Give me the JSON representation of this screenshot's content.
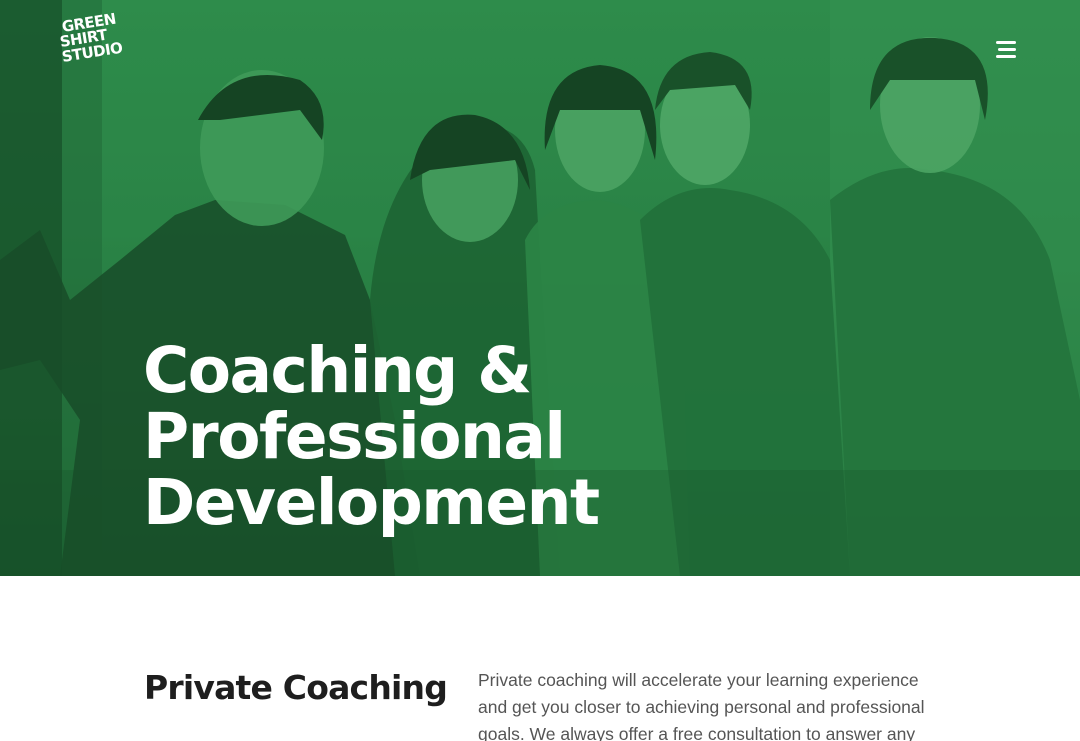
{
  "header": {
    "logo_lines": [
      "GREEN",
      "SHIRT",
      "STUDIO"
    ],
    "menu_icon": "hamburger-menu-icon"
  },
  "hero": {
    "title_lines": [
      "Coaching &",
      "Professional",
      "Development"
    ],
    "overlay_color": "#2a8446"
  },
  "section": {
    "title": "Private Coaching",
    "body": "Private coaching will accelerate your learning experience and get you closer to achieving personal and professional goals. We always offer a free consultation to answer any"
  },
  "colors": {
    "accent": "#2a8446",
    "text_dark": "#1e1e1e",
    "text_body": "#555555"
  }
}
